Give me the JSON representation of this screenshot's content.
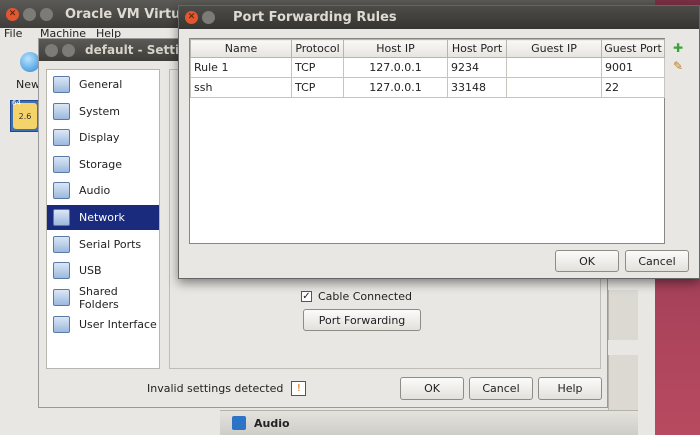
{
  "main_window": {
    "title": "Oracle VM Virtual",
    "menu": [
      "File",
      "Machine",
      "Help"
    ],
    "toolbar_new": "New",
    "vm_badge": "64",
    "vm_version": "2.6"
  },
  "settings": {
    "title": "default - Settin",
    "categories": [
      {
        "label": "General",
        "icon": "general-icon"
      },
      {
        "label": "System",
        "icon": "system-icon"
      },
      {
        "label": "Display",
        "icon": "display-icon"
      },
      {
        "label": "Storage",
        "icon": "storage-icon"
      },
      {
        "label": "Audio",
        "icon": "audio-icon"
      },
      {
        "label": "Network",
        "icon": "network-icon"
      },
      {
        "label": "Serial Ports",
        "icon": "serial-ports-icon"
      },
      {
        "label": "USB",
        "icon": "usb-icon"
      },
      {
        "label": "Shared Folders",
        "icon": "shared-folders-icon"
      },
      {
        "label": "User Interface",
        "icon": "user-interface-icon"
      }
    ],
    "selected_category": "Network",
    "cable_connected": {
      "label": "Cable Connected",
      "checked": true
    },
    "port_forwarding_button": "Port Forwarding",
    "invalid_settings": "Invalid settings detected",
    "ok": "OK",
    "cancel": "Cancel",
    "help": "Help"
  },
  "background": {
    "audio_section": "Audio"
  },
  "port_forwarding": {
    "title": "Port Forwarding Rules",
    "columns": [
      "Name",
      "Protocol",
      "Host IP",
      "Host Port",
      "Guest IP",
      "Guest Port"
    ],
    "rows": [
      {
        "name": "Rule 1",
        "protocol": "TCP",
        "host_ip": "127.0.0.1",
        "host_port": "9234",
        "guest_ip": "",
        "guest_port": "9001"
      },
      {
        "name": "ssh",
        "protocol": "TCP",
        "host_ip": "127.0.0.1",
        "host_port": "33148",
        "guest_ip": "",
        "guest_port": "22"
      }
    ],
    "ok": "OK",
    "cancel": "Cancel"
  },
  "colors": {
    "selection": "#1a2a7c",
    "titlebar": "#3e3d39",
    "close_button": "#e2572f",
    "add_rule_icon": "#3aa23a"
  }
}
